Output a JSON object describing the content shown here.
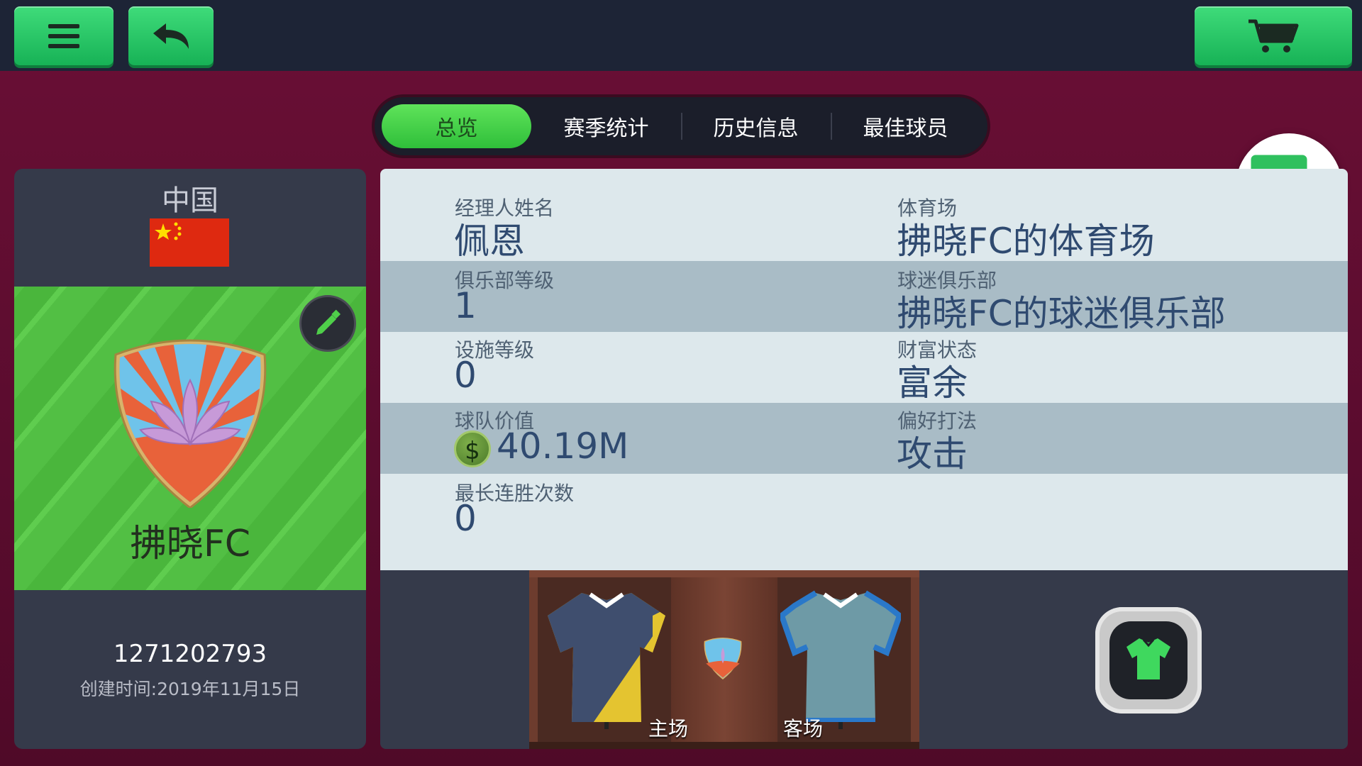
{
  "topbar": {
    "menu_icon": "menu-icon",
    "back_icon": "back-arrow-icon",
    "cart_icon": "cart-icon"
  },
  "tabs": [
    {
      "label": "总览",
      "active": true
    },
    {
      "label": "赛季统计",
      "active": false
    },
    {
      "label": "历史信息",
      "active": false
    },
    {
      "label": "最佳球员",
      "active": false
    }
  ],
  "club": {
    "country": "中国",
    "name": "拂晓FC",
    "id": "1271202793",
    "created": "创建时间:2019年11月15日"
  },
  "info": {
    "manager": {
      "label": "经理人姓名",
      "value": "佩恩"
    },
    "stadium": {
      "label": "体育场",
      "value": "拂晓FC的体育场"
    },
    "club_level": {
      "label": "俱乐部等级",
      "value": "1"
    },
    "fan_club": {
      "label": "球迷俱乐部",
      "value": "拂晓FC的球迷俱乐部"
    },
    "facility_level": {
      "label": "设施等级",
      "value": "0"
    },
    "wealth": {
      "label": "财富状态",
      "value": "富余"
    },
    "team_value": {
      "label": "球队价值",
      "value": "40.19M",
      "currency_symbol": "$"
    },
    "play_style": {
      "label": "偏好打法",
      "value": "攻击"
    },
    "win_streak": {
      "label": "最长连胜次数",
      "value": "0"
    }
  },
  "wardrobe": {
    "home_label": "主场",
    "away_label": "客场"
  },
  "colors": {
    "accent_green": "#2fbf3a",
    "background": "#5a0c2e",
    "topbar": "#1d2436",
    "panel_dark": "#353a4a",
    "info_light": "#dde8ec",
    "info_shade": "#a9bcc6"
  }
}
